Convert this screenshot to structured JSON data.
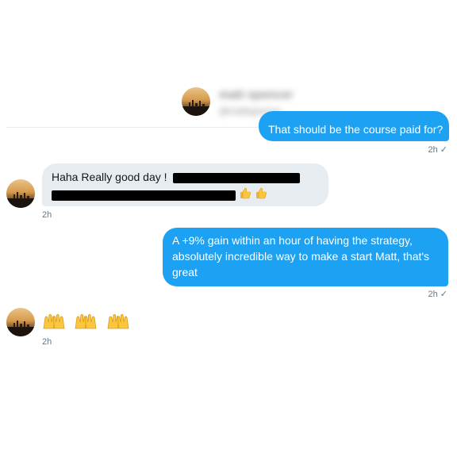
{
  "header": {
    "contact_name": "matt spencer",
    "contact_handle": "@mattspencer"
  },
  "messages": [
    {
      "direction": "outgoing",
      "text": "That should be the course paid for?",
      "time": "2h",
      "receipt": "✓"
    },
    {
      "direction": "incoming",
      "text": "Haha Really good day !",
      "time": "2h",
      "redacted": true,
      "emoji_icons": [
        "thumbs-up-icon",
        "thumbs-up-icon"
      ]
    },
    {
      "direction": "outgoing",
      "text": "A +9% gain within an hour of having the strategy, absolutely incredible way to make a start Matt, that's great",
      "time": "2h",
      "receipt": "✓"
    },
    {
      "direction": "incoming",
      "emoji_icons": [
        "raising-hands-icon",
        "raising-hands-icon",
        "raising-hands-icon"
      ],
      "time": "2h"
    }
  ],
  "colors": {
    "outgoing_bubble": "#1da1f2",
    "incoming_bubble": "#e6ecf0",
    "timestamp": "#657786",
    "divider": "#e6ecf0"
  }
}
